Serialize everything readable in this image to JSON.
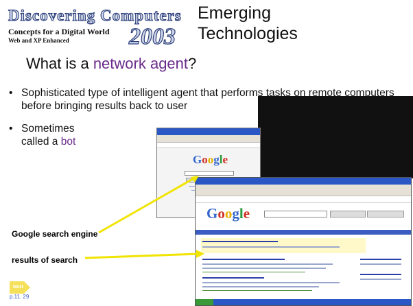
{
  "header": {
    "logo_title": "Discovering Computers 2003",
    "logo_line1": "Concepts for a Digital World",
    "logo_line2": "Web and XP Enhanced",
    "title_line1": "Emerging",
    "title_line2": "Technologies"
  },
  "heading": {
    "prefix": "What is a ",
    "highlight": "network agent",
    "suffix": "?"
  },
  "bullets": [
    {
      "text": "Sophisticated type of intelligent agent that performs tasks on remote computers before bringing results back to user"
    },
    {
      "prefix": "Sometimes called a ",
      "highlight": "bot"
    }
  ],
  "callouts": {
    "search_engine": "Google search engine",
    "results": "results of search"
  },
  "screenshots": {
    "search_logo": "Google",
    "results_logo": "Google"
  },
  "nav": {
    "next_label": "Next",
    "page_ref": "p.11. 29"
  },
  "colors": {
    "highlight": "#6a2a8a",
    "arrow": "#f0e400",
    "window_title_bar": "#2a56c6"
  }
}
